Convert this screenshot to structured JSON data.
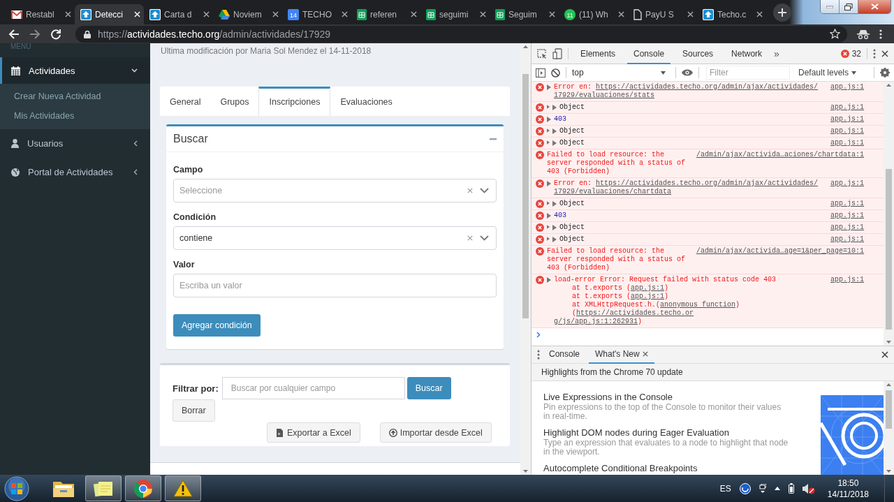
{
  "browser": {
    "tabs": [
      {
        "kind": "mail",
        "title": "Restabl",
        "selected": false
      },
      {
        "kind": "site",
        "title": "Detecci",
        "selected": true
      },
      {
        "kind": "site",
        "title": "Carta d",
        "selected": false
      },
      {
        "kind": "drive",
        "title": "Noviem",
        "selected": false
      },
      {
        "kind": "calendar",
        "title": "TECHO",
        "icon_text": "14",
        "selected": false
      },
      {
        "kind": "sheet",
        "title": "referen",
        "selected": false
      },
      {
        "kind": "sheet",
        "title": "seguimi",
        "selected": false
      },
      {
        "kind": "sheet",
        "title": "Seguim",
        "selected": false
      },
      {
        "kind": "chat",
        "title": "(11) Wh",
        "icon_text": "11",
        "selected": false
      },
      {
        "kind": "doc",
        "title": "PayU S",
        "selected": false
      },
      {
        "kind": "site",
        "title": "Techo.c",
        "selected": false
      }
    ],
    "url": {
      "scheme": "https://",
      "host": "actividades.techo.org",
      "path": "/admin/actividades/17929"
    }
  },
  "sidebar": {
    "header": "MENU",
    "items": [
      {
        "kind": "calendar",
        "label": "Actividades",
        "selected": true,
        "expanded": true,
        "children": [
          {
            "label": "Crear Nueva Actividad"
          },
          {
            "label": "Mis Actividades"
          }
        ]
      },
      {
        "kind": "user",
        "label": "Usuarios",
        "selected": false,
        "expanded": false
      },
      {
        "kind": "globe",
        "label": "Portal de Actividades",
        "selected": false,
        "expanded": false
      }
    ]
  },
  "page": {
    "subtitle": "Ultima modificación por Maria Sol Mendez el 14-11-2018",
    "tabs": [
      {
        "label": "General",
        "selected": false
      },
      {
        "label": "Grupos",
        "selected": false
      },
      {
        "label": "Inscripciones",
        "selected": true
      },
      {
        "label": "Evaluaciones",
        "selected": false
      }
    ],
    "search_box": {
      "title": "Buscar",
      "fields": [
        {
          "kind": "select",
          "label": "Campo",
          "placeholder": "Seleccione"
        },
        {
          "kind": "select",
          "label": "Condición",
          "value": "contiene"
        },
        {
          "kind": "input",
          "label": "Valor",
          "placeholder": "Escriba un valor"
        }
      ],
      "button": "Agregar condición"
    },
    "filter_box": {
      "label": "Filtrar por:",
      "placeholder": "Buscar por cualquier campo",
      "search_button": "Buscar",
      "clear_button": "Borrar",
      "export_button": "Exportar a Excel",
      "import_button": "Importar desde Excel"
    }
  },
  "devtools": {
    "tabs": [
      {
        "label": "Elements",
        "selected": false
      },
      {
        "label": "Console",
        "selected": true
      },
      {
        "label": "Sources",
        "selected": false
      },
      {
        "label": "Network",
        "selected": false
      }
    ],
    "more_tabs": "»",
    "error_count": "32",
    "context": "top",
    "filter_placeholder": "Filter",
    "levels": "Default levels",
    "messages": [
      {
        "kind": "error",
        "expandable": true,
        "text": "Error en: ",
        "link": [
          "https://actividades.techo.org/admin/ajax/actividades/",
          "17929/evaluaciones/stats"
        ],
        "source": "app.js:1"
      },
      {
        "kind": "object",
        "text": "Object",
        "source": "app.js:1"
      },
      {
        "kind": "number",
        "text": "403",
        "source": "app.js:1"
      },
      {
        "kind": "object",
        "text": "Object",
        "source": "app.js:1"
      },
      {
        "kind": "object",
        "text": "Object",
        "source": "app.js:1"
      },
      {
        "kind": "network",
        "text": "Failed to load resource: the server responded with a status of 403 (Forbidden)",
        "source": "/admin/ajax/activida…aciones/chartdata:1"
      },
      {
        "kind": "error",
        "expandable": true,
        "text": "Error en: ",
        "link": [
          "https://actividades.techo.org/admin/ajax/actividades/",
          "17929/evaluaciones/chartdata"
        ],
        "source": "app.js:1"
      },
      {
        "kind": "object",
        "text": "Object",
        "source": "app.js:1"
      },
      {
        "kind": "number",
        "text": "403",
        "source": "app.js:1"
      },
      {
        "kind": "object",
        "text": "Object",
        "source": "app.js:1"
      },
      {
        "kind": "object",
        "text": "Object",
        "source": "app.js:1"
      },
      {
        "kind": "network",
        "text": "Failed to load resource: the server responded with a status of 403 (Forbidden)",
        "source": "/admin/ajax/activida…age=1&per_page=10:1"
      },
      {
        "kind": "error",
        "expandable": true,
        "text": "load-error Error: Request failed with status code 403",
        "source": "app.js:1",
        "stack": [
          [
            {
              "text": "at t.exports ("
            },
            {
              "text": "app.js:1",
              "link": true
            },
            {
              "text": ")"
            }
          ],
          [
            {
              "text": "at t.exports ("
            },
            {
              "text": "app.js:1",
              "link": true
            },
            {
              "text": ")"
            }
          ],
          [
            {
              "text": "at XMLHttpRequest.h.("
            },
            {
              "text": "anonymous function",
              "link": true
            },
            {
              "text": ") ("
            },
            {
              "text": "https://actividades.techo.or",
              "link": true
            },
            {
              "text": "g/js/app.js:1:262931",
              "link": true,
              "break_before": true
            },
            {
              "text": ")"
            }
          ]
        ]
      }
    ],
    "drawer": {
      "tabs": [
        {
          "label": "Console",
          "selected": false,
          "closable": false
        },
        {
          "label": "What's New",
          "selected": true,
          "closable": true
        }
      ],
      "header": "Highlights from the Chrome 70 update",
      "features": [
        {
          "title": "Live Expressions in the Console",
          "description": "Pin expressions to the top of the Console to monitor their values in real-time."
        },
        {
          "title": "Highlight DOM nodes during Eager Evaluation",
          "description": "Type an expression that evaluates to a node to highlight that node in the viewport."
        },
        {
          "title": "Autocomplete Conditional Breakpoints"
        }
      ]
    }
  },
  "taskbar": {
    "apps": [
      {
        "kind": "folder",
        "open": false
      },
      {
        "kind": "notes",
        "open": true
      },
      {
        "kind": "browser",
        "open": true
      },
      {
        "kind": "warning",
        "open": true
      }
    ],
    "tray": {
      "language": "ES",
      "time": "18:50",
      "date": "14/11/2018"
    }
  }
}
